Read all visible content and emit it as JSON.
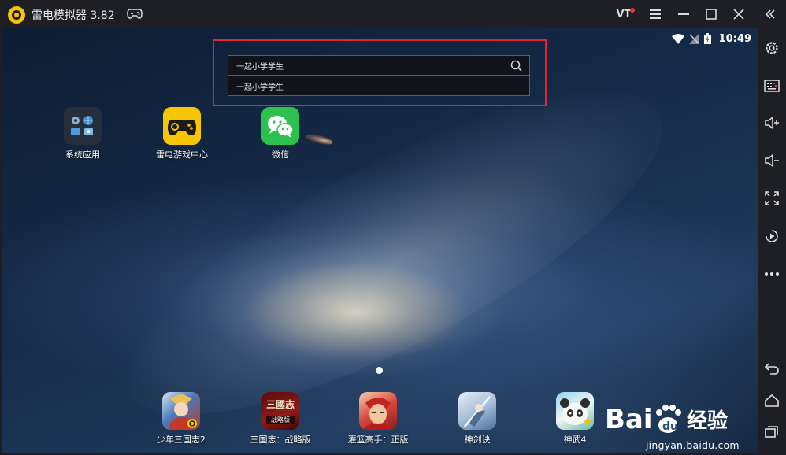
{
  "window": {
    "title": "雷电模拟器 3.82",
    "vt_label": "VT"
  },
  "status_bar": {
    "time": "10:49"
  },
  "search": {
    "query": "一起小学学生",
    "suggestions": [
      "一起小学学生"
    ]
  },
  "desktop_apps": [
    {
      "label": "系统应用",
      "icon": "system-apps-folder-icon"
    },
    {
      "label": "雷电游戏中心",
      "icon": "leidian-game-center-icon"
    },
    {
      "label": "微信",
      "icon": "wechat-icon"
    }
  ],
  "dock_apps": [
    {
      "label": "少年三国志2",
      "icon": "shaonian-sanguozhi2-icon"
    },
    {
      "label": "三国志：战略版",
      "icon": "sanguozhi-zhanlue-icon",
      "icon_text_top": "三國志",
      "icon_text_bottom": "战略版"
    },
    {
      "label": "灌篮高手：正版",
      "icon": "slam-dunk-icon"
    },
    {
      "label": "神剑诀",
      "icon": "shenjianjue-icon"
    },
    {
      "label": "神武4",
      "icon": "shenwu4-icon"
    }
  ],
  "watermark": {
    "url": "jingyan.baidu.com"
  },
  "colors": {
    "highlight_frame": "#e0262d",
    "brand_yellow": "#f7c600",
    "wechat_green": "#2dc14f"
  }
}
